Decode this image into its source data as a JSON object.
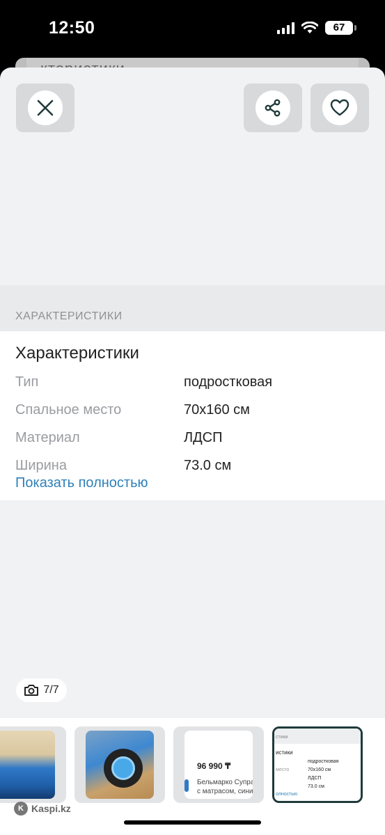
{
  "status_bar": {
    "time": "12:50",
    "battery": "67",
    "icons": [
      "cellular-signal-icon",
      "wifi-icon",
      "battery-icon"
    ]
  },
  "background_sheet": {
    "peek_text": "ктеристики"
  },
  "toolbar": {
    "close_icon": "close-icon",
    "share_icon": "share-icon",
    "favorite_icon": "heart-icon"
  },
  "section": {
    "header": "ХАРАКТЕРИСТИКИ"
  },
  "specs": {
    "title": "Характеристики",
    "rows": [
      {
        "label": "Тип",
        "value": "подростковая"
      },
      {
        "label": "Спальное место",
        "value": "70x160 см"
      },
      {
        "label": "Материал",
        "value": "ЛДСП"
      },
      {
        "label": "Ширина",
        "value": "73.0 см"
      }
    ],
    "show_all": "Показать полностью"
  },
  "photo_counter": {
    "text": "7/7",
    "icon": "camera-icon"
  },
  "thumbnails": {
    "product_price": "96 990 ₸",
    "product_name_line1": "Бельмарко Супра",
    "product_name_line2": "с матрасом, сини",
    "mini": {
      "header": "стики",
      "title": "истики",
      "value1": "подростковая",
      "label2": "место",
      "value2": "70x160 см",
      "value3": "ЛДСП",
      "value4": "73.0 см",
      "link": "олностью"
    }
  },
  "footer": {
    "brand": "Kaspi.kz"
  },
  "colors": {
    "accent_link": "#2f80b8",
    "sheet_bg": "#f1f2f4",
    "button_bg": "#d8d9db"
  }
}
